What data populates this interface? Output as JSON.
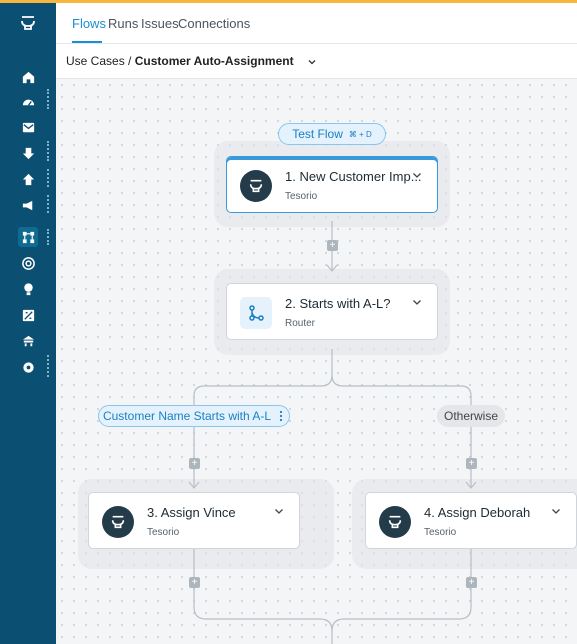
{
  "nav": {
    "tabs": [
      "Flows",
      "Runs",
      "Issues",
      "Connections"
    ],
    "active_tab": "Flows"
  },
  "breadcrumb": {
    "parent": "Use Cases /",
    "current": "Customer Auto-Assignment"
  },
  "test_flow": {
    "label": "Test Flow",
    "shortcut": "⌘ + D"
  },
  "nodes": [
    {
      "title": "1. New Customer Imp...",
      "subtitle": "Tesorio",
      "icon": "tesorio-logo-icon",
      "selected": true
    },
    {
      "title": "2. Starts with A-L?",
      "subtitle": "Router",
      "icon": "router-icon"
    },
    {
      "title": "3. Assign Vince",
      "subtitle": "Tesorio",
      "icon": "tesorio-logo-icon"
    },
    {
      "title": "4. Assign Deborah",
      "subtitle": "Tesorio",
      "icon": "tesorio-logo-icon"
    }
  ],
  "branches": {
    "left": "Customer Name Starts with A-L",
    "right": "Otherwise"
  },
  "plus_label": "+",
  "colors": {
    "sidebar": "#0b4f73",
    "accent": "#1a8fd1",
    "node_icon": "#243b4a"
  }
}
